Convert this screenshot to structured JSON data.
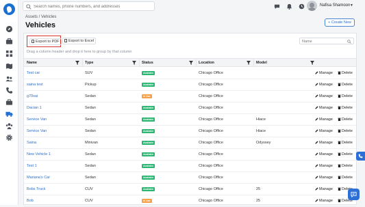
{
  "header": {
    "search_placeholder": "Search names, phone numbers, and addresses",
    "user_name": "Nafisa Shamoon"
  },
  "breadcrumb": "Assets / Vehicles",
  "page_title": "Vehicles",
  "create_button": "+ Create New",
  "toolbar": {
    "export_pdf": "Export to PDF",
    "export_excel": "Export to Excel",
    "name_filter_placeholder": "Name",
    "group_hint": "Drag a column header and drop it here to group by that column"
  },
  "columns": [
    "Name",
    "Type",
    "Status",
    "Location",
    "Model"
  ],
  "actions": {
    "manage": "Manage",
    "delete": "Delete"
  },
  "status_colors": {
    "Available": "#2bb673",
    "In Use": "#f5a04a"
  },
  "rows": [
    {
      "name": "Test car",
      "type": "SUV",
      "status": "Available",
      "location": "Chicago Office",
      "model": ""
    },
    {
      "name": "saina test",
      "type": "Pickup",
      "status": "Available",
      "location": "Chicago Office",
      "model": ""
    },
    {
      "name": "g70sai",
      "type": "Sedan",
      "status": "In Use",
      "location": "Chicago Office",
      "model": ""
    },
    {
      "name": "Dacian 1",
      "type": "Sedan",
      "status": "Available",
      "location": "Chicago Office",
      "model": ""
    },
    {
      "name": "Service Van",
      "type": "Sedan",
      "status": "Available",
      "location": "Chicago Office",
      "model": "Hiace"
    },
    {
      "name": "Service Van",
      "type": "Sedan",
      "status": "Available",
      "location": "Chicago Office",
      "model": "Hiace"
    },
    {
      "name": "Saina",
      "type": "Minivan",
      "status": "Available",
      "location": "Chicago Office",
      "model": "Odyssey"
    },
    {
      "name": "New Vehicle 1",
      "type": "Sedan",
      "status": "Available",
      "location": "Chicago Office",
      "model": ""
    },
    {
      "name": "Test 1",
      "type": "Sedan",
      "status": "Available",
      "location": "Chicago Office",
      "model": ""
    },
    {
      "name": "Mariana's Car",
      "type": "Sedan",
      "status": "Available",
      "location": "Chicago Office",
      "model": ""
    },
    {
      "name": "Bobs Truck",
      "type": "CUV",
      "status": "Available",
      "location": "Chicago Office",
      "model": "25"
    },
    {
      "name": "Bob",
      "type": "CUV",
      "status": "In Use",
      "location": "Chicago Office",
      "model": "25"
    }
  ]
}
